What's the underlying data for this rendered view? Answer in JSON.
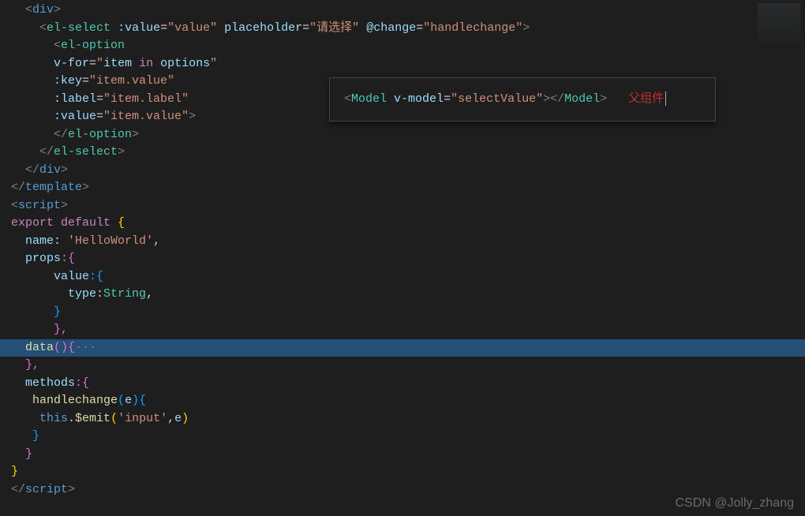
{
  "code": {
    "l1_indent": "  ",
    "l1_open": "<",
    "l1_tag": "div",
    "l1_close": ">",
    "l2_indent": "    ",
    "l2_open": "<",
    "l2_tag": "el-select",
    "l2_sp": " ",
    "l2_attr1": ":value",
    "l2_eq": "=",
    "l2_val1": "\"value\"",
    "l2_attr2": "placeholder",
    "l2_val2": "\"请选择\"",
    "l2_attr3": "@change",
    "l2_val3": "\"handlechange\"",
    "l2_close": ">",
    "l3_indent": "      ",
    "l3_open": "<",
    "l3_tag": "el-option",
    "l4_indent": "      ",
    "l4_attr": "v-for",
    "l4_eq": "=",
    "l4_q1": "\"",
    "l4_item": "item",
    "l4_in": " in ",
    "l4_options": "options",
    "l4_q2": "\"",
    "l5_indent": "      ",
    "l5_attr": ":key",
    "l5_eq": "=",
    "l5_val": "\"item.value\"",
    "l6_indent": "      ",
    "l6_attr": ":label",
    "l6_eq": "=",
    "l6_val": "\"item.label\"",
    "l7_indent": "      ",
    "l7_attr": ":value",
    "l7_eq": "=",
    "l7_val": "\"item.value\"",
    "l7_close": ">",
    "l8_indent": "      ",
    "l8_open": "</",
    "l8_tag": "el-option",
    "l8_close": ">",
    "l9_indent": "    ",
    "l9_open": "</",
    "l9_tag": "el-select",
    "l9_close": ">",
    "l10_indent": "  ",
    "l10_open": "</",
    "l10_tag": "div",
    "l10_close": ">",
    "l11_open": "</",
    "l11_tag": "template",
    "l11_close": ">",
    "l12_open": "<",
    "l12_tag": "script",
    "l12_close": ">",
    "l13_export": "export",
    "l13_default": " default",
    "l13_brace": " {",
    "l14_indent": "  ",
    "l14_name": "name",
    "l14_colon": ": ",
    "l14_val": "'HelloWorld'",
    "l14_comma": ",",
    "l15_indent": "  ",
    "l15_props": "props",
    "l15_colon": ":{",
    "l16_indent": "      ",
    "l16_value": "value",
    "l16_colon": ":{",
    "l17_indent": "        ",
    "l17_type": "type",
    "l17_colon": ":",
    "l17_string": "String",
    "l17_comma": ",",
    "l18_indent": "      ",
    "l18_brace": "}",
    "l19_indent": "      ",
    "l19_brace": "},",
    "l20_indent": "  ",
    "l20_data": "data",
    "l20_paren": "()",
    "l20_brace": "{",
    "l20_fold": "···",
    "l21_indent": "  ",
    "l21_brace": "},",
    "l22_indent": "  ",
    "l22_methods": "methods",
    "l22_colon": ":{",
    "l23_indent": "   ",
    "l23_func": "handlechange",
    "l23_open": "(",
    "l23_param": "e",
    "l23_close": ")",
    "l23_brace": "{",
    "l24_indent": "    ",
    "l24_this": "this",
    "l24_dot": ".",
    "l24_emit": "$emit",
    "l24_open": "(",
    "l24_arg1": "'input'",
    "l24_comma": ",",
    "l24_arg2": "e",
    "l24_close": ")",
    "l25_indent": "   ",
    "l25_brace": "}",
    "l26_indent": "  ",
    "l26_brace": "}",
    "l27_brace": "}",
    "l28_open": "</",
    "l28_tag": "script",
    "l28_close": ">"
  },
  "inset": {
    "open": "<",
    "tag": "Model",
    "sp": " ",
    "attr": "v-model",
    "eq": "=",
    "val": "\"selectValue\"",
    "close1": ">",
    "open2": "</",
    "tag2": "Model",
    "close2": ">",
    "comment": "   父组件"
  },
  "watermark": "CSDN @Jolly_zhang"
}
